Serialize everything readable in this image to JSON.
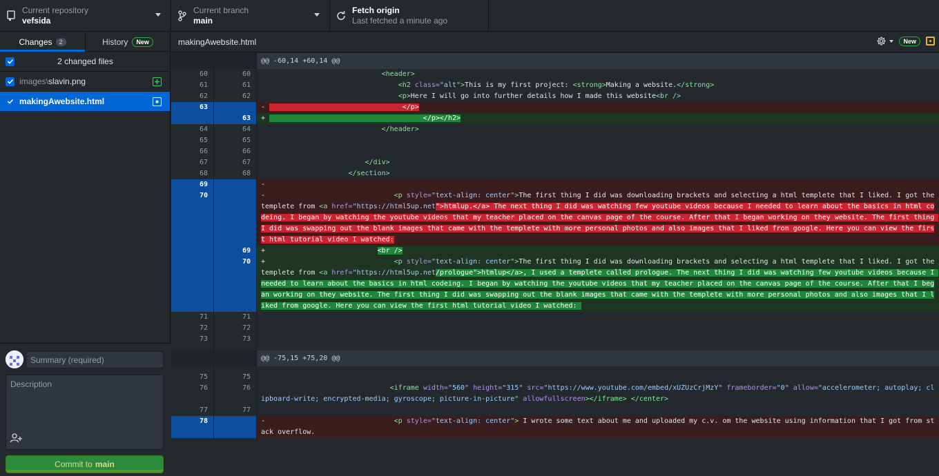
{
  "toolbar": {
    "repo_label": "Current repository",
    "repo_name": "vefsida",
    "branch_label": "Current branch",
    "branch_name": "main",
    "fetch_title": "Fetch origin",
    "fetch_sub": "Last fetched a minute ago"
  },
  "sidebar": {
    "tabs": [
      {
        "label": "Changes",
        "badge": "2"
      },
      {
        "label": "History",
        "badge": "New"
      }
    ],
    "changed_files_label": "2 changed files",
    "files": [
      {
        "dir": "images\\",
        "name": "slavin.png",
        "status": "added"
      },
      {
        "dir": "",
        "name": "makingAwebsite.html",
        "status": "modified"
      }
    ]
  },
  "commit": {
    "summary_placeholder": "Summary (required)",
    "description_placeholder": "Description",
    "button_prefix": "Commit to",
    "button_branch": "main"
  },
  "diff": {
    "filename": "makingAwebsite.html",
    "new_badge": "New"
  },
  "colors": {
    "accent": "#0366d6",
    "added": "#22863a",
    "deleted": "#cb2431",
    "commit_button": "#2c8a3c"
  },
  "icons": [
    "repo-icon",
    "branch-icon",
    "sync-icon",
    "gear-icon",
    "bell-icon",
    "coauthor-icon",
    "check-icon",
    "file-added-icon",
    "file-modified-icon"
  ]
}
